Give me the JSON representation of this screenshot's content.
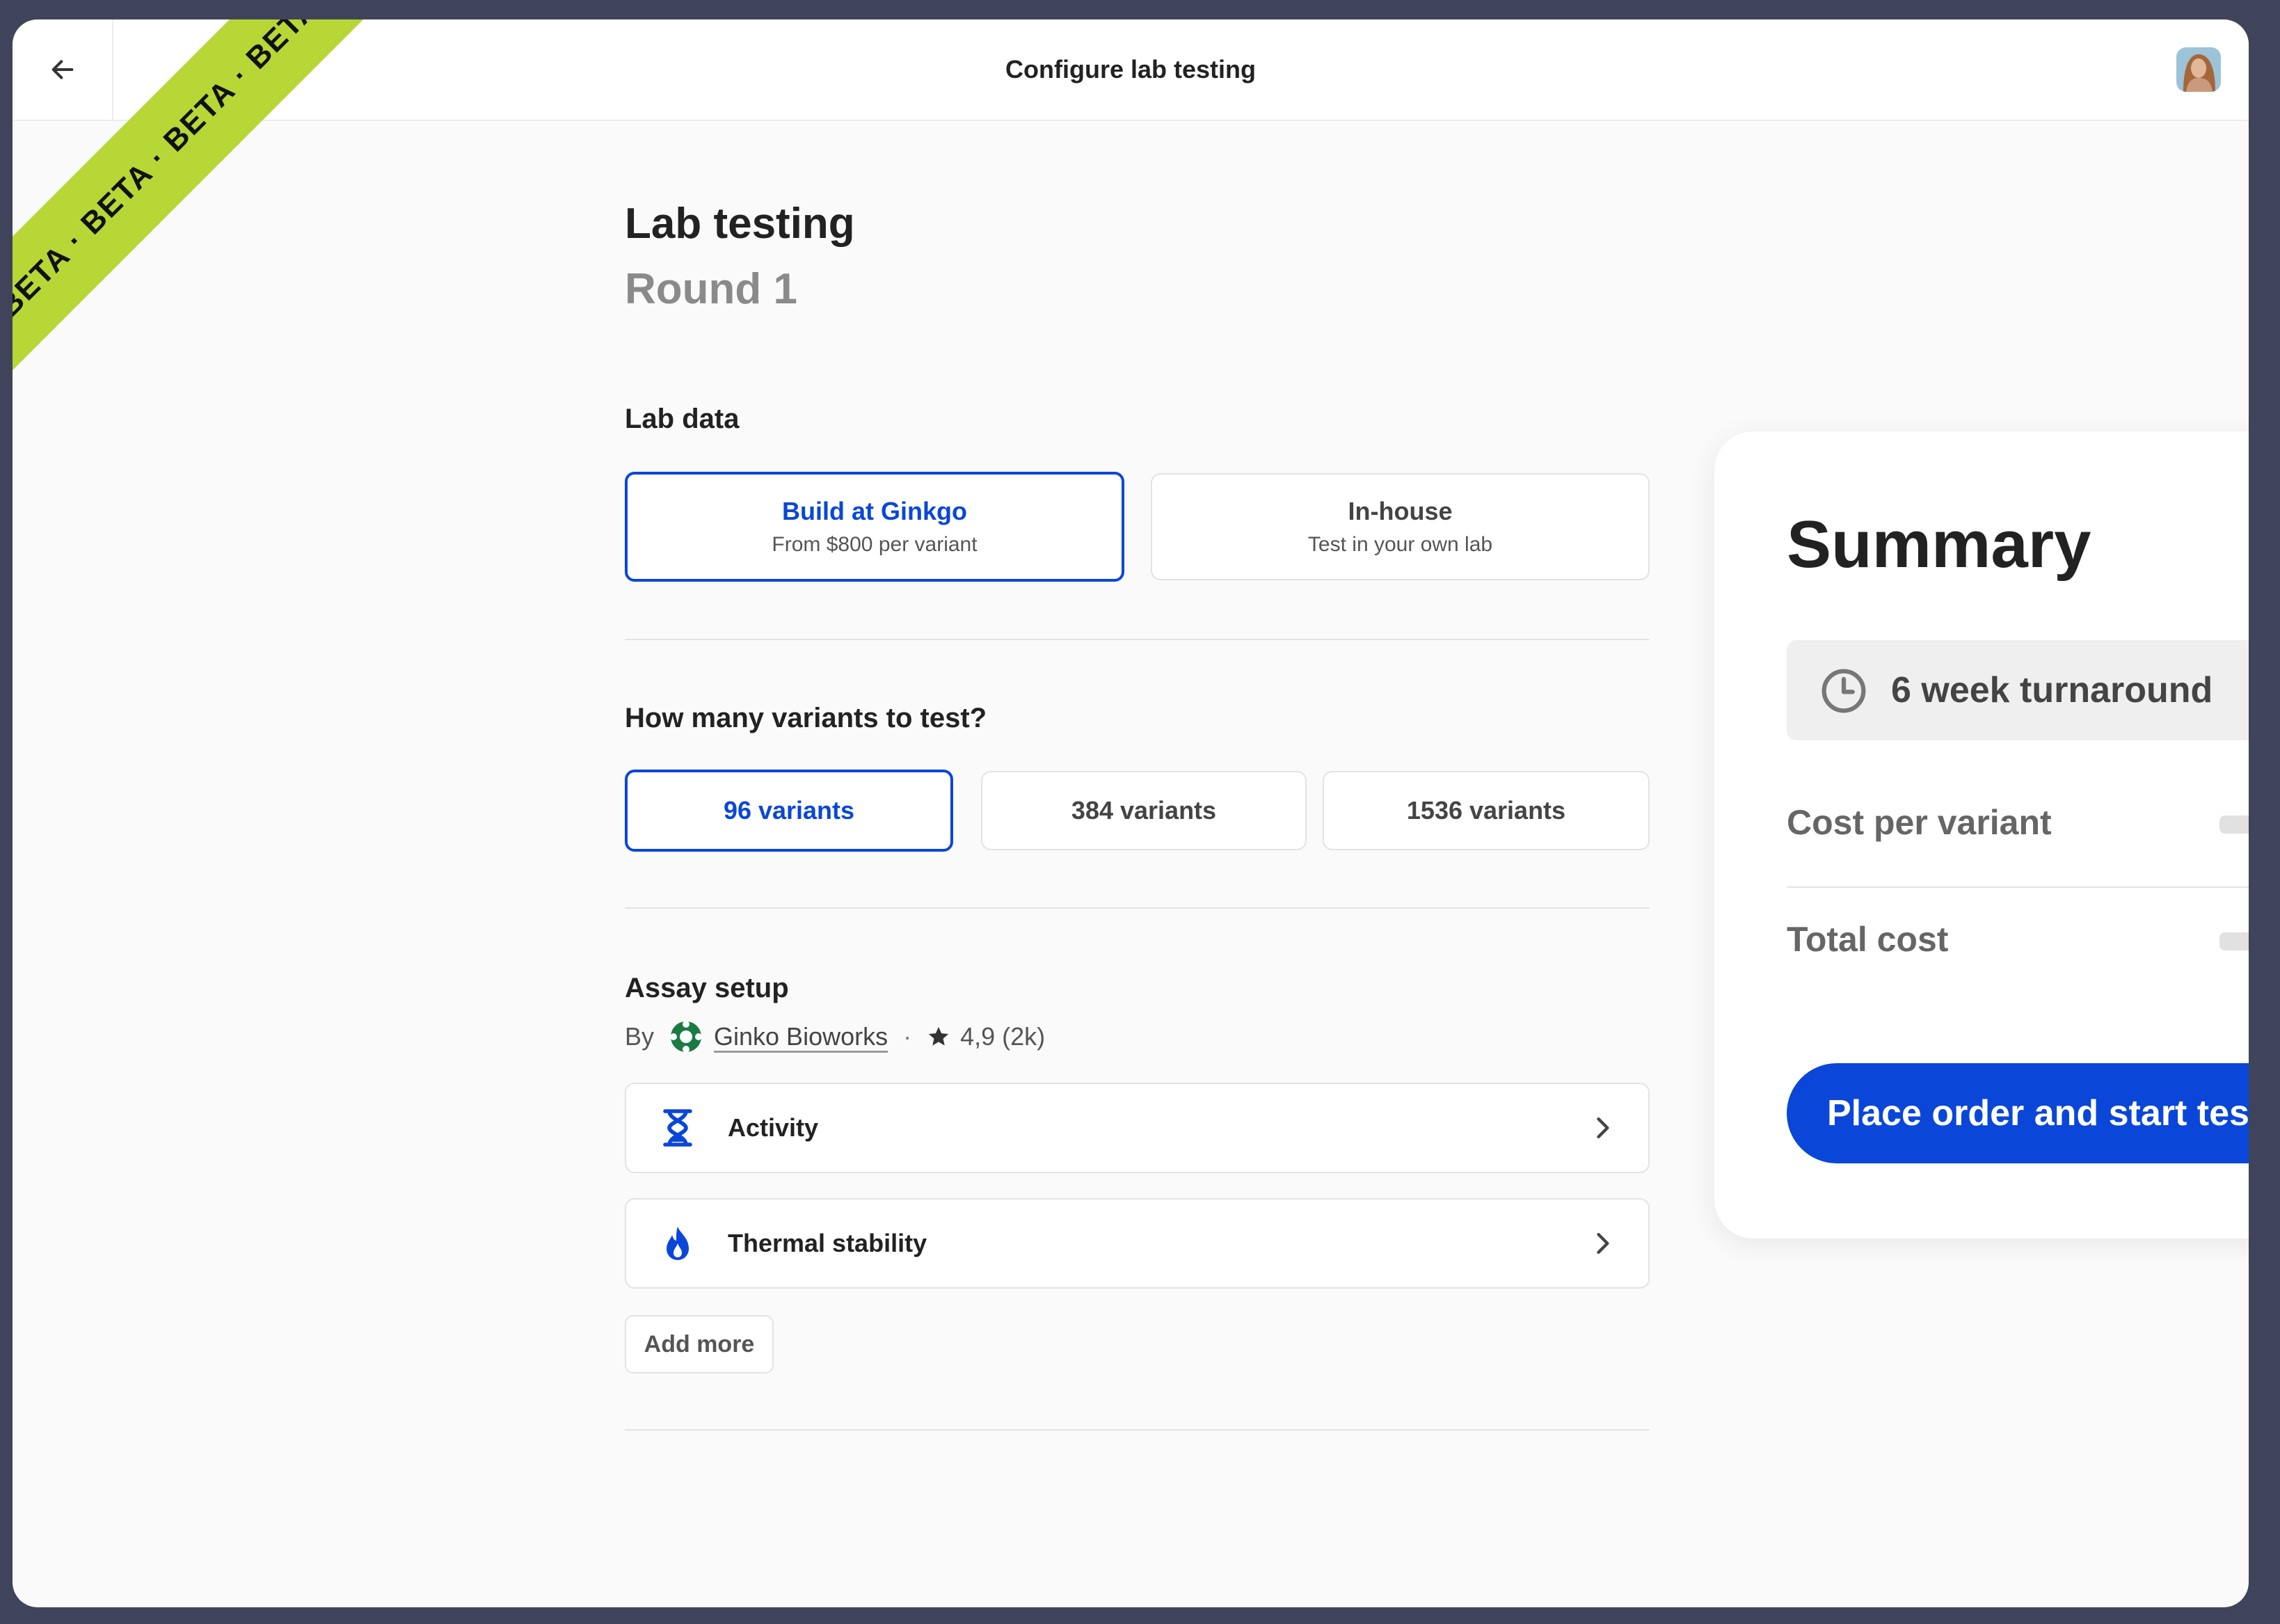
{
  "header": {
    "title": "Configure lab testing",
    "back_label": "Back"
  },
  "ribbon": {
    "text": "BETA  ·  BETA  ·  BETA  ·  BETA",
    "color": "#b7d736"
  },
  "page": {
    "title": "Lab testing",
    "subtitle": "Round 1"
  },
  "lab_data": {
    "label": "Lab data",
    "options": [
      {
        "title": "Build at Ginkgo",
        "subtitle": "From $800 per variant",
        "selected": true
      },
      {
        "title": "In-house",
        "subtitle": "Test in your own lab",
        "selected": false
      }
    ]
  },
  "variants": {
    "label": "How many variants to test?",
    "options": [
      {
        "label": "96 variants",
        "selected": true
      },
      {
        "label": "384 variants",
        "selected": false
      },
      {
        "label": "1536 variants",
        "selected": false
      }
    ]
  },
  "assay": {
    "label": "Assay setup",
    "by": "By",
    "vendor": "Ginko Bioworks",
    "separator": "·",
    "rating": "4,9 (2k)",
    "items": [
      {
        "label": "Activity",
        "icon": "hourglass-icon"
      },
      {
        "label": "Thermal stability",
        "icon": "flame-icon"
      }
    ],
    "add_more": "Add more"
  },
  "summary": {
    "title": "Summary",
    "turnaround": "6 week turnaround",
    "cost_per_variant_label": "Cost per variant",
    "total_cost_label": "Total cost",
    "cta": "Place order and start testing"
  },
  "colors": {
    "accent": "#0a47d8",
    "beta_ribbon": "#b7d736",
    "vendor_logo": "#1a7a44"
  }
}
